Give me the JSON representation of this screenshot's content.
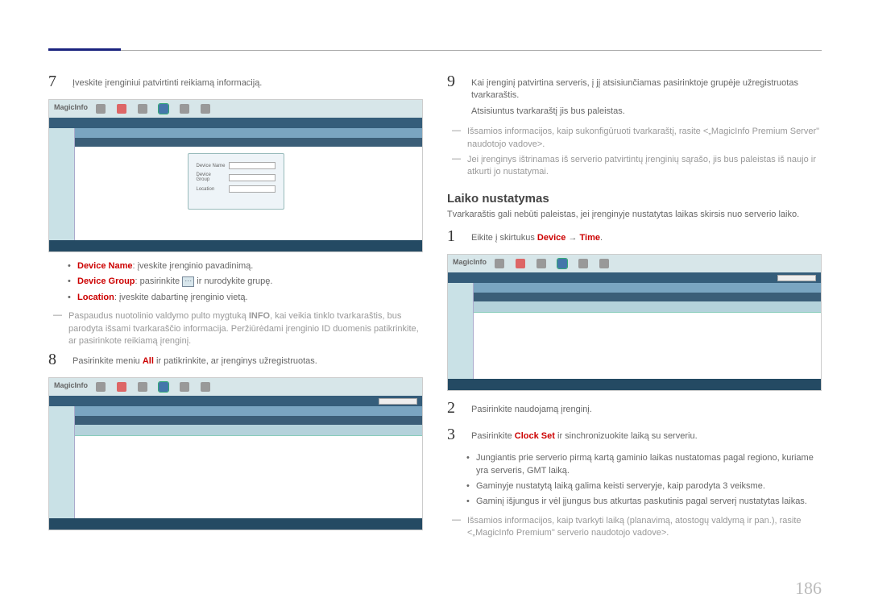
{
  "page_number": "186",
  "left": {
    "step7": {
      "num": "7",
      "text": "Įveskite įrenginiui patvirtinti reikiamą informaciją."
    },
    "bullets": [
      {
        "label": "Device Name",
        "text": ": įveskite įrenginio pavadinimą."
      },
      {
        "label": "Device Group",
        "text_before": ": pasirinkite ",
        "text_after": " ir nurodykite grupę."
      },
      {
        "label": "Location",
        "text": ": įveskite dabartinę įrenginio vietą."
      }
    ],
    "note7": {
      "text": "Paspaudus nuotolinio valdymo pulto mygtuką ",
      "bold": "INFO",
      "text2": ", kai veikia tinklo tvarkaraštis, bus parodyta išsami tvarkaraščio informacija. Peržiūrėdami įrenginio ID duomenis patikrinkite, ar pasirinkote reikiamą įrenginį."
    },
    "step8": {
      "num": "8",
      "pre": "Pasirinkite meniu ",
      "red": "All",
      "post": " ir patikrinkite, ar įrenginys užregistruotas."
    }
  },
  "right": {
    "step9": {
      "num": "9",
      "line1": "Kai įrenginį patvirtina serveris, į jį atsisiunčiamas pasirinktoje grupėje užregistruotas tvarkaraštis.",
      "line2": "Atsisiuntus tvarkaraštį jis bus paleistas."
    },
    "note9a": "Išsamios informacijos, kaip sukonfigūruoti tvarkaraštį, rasite <„MagicInfo Premium Server\" naudotojo vadove>.",
    "note9b": "Jei įrenginys ištrinamas iš serverio patvirtintų įrenginių sąrašo, jis bus paleistas iš naujo ir atkurti jo nustatymai.",
    "section_title": "Laiko nustatymas",
    "section_intro": "Tvarkaraštis gali nebūti paleistas, jei įrenginyje nustatytas laikas skirsis nuo serverio laiko.",
    "step1": {
      "num": "1",
      "pre": "Eikite į skirtukus ",
      "red1": "Device",
      "arrow": " → ",
      "red2": "Time",
      "post": "."
    },
    "step2": {
      "num": "2",
      "text": "Pasirinkite naudojamą įrenginį."
    },
    "step3": {
      "num": "3",
      "pre": "Pasirinkite ",
      "red": "Clock Set",
      "post": " ir sinchronizuokite laiką su serveriu."
    },
    "bullets2": [
      "Jungiantis prie serverio pirmą kartą gaminio laikas nustatomas pagal regiono, kuriame yra serveris, GMT laiką.",
      "Gaminyje nustatytą laiką galima keisti serveryje, kaip parodyta 3 veiksme.",
      "Gaminį išjungus ir vėl įjungus bus atkurtas paskutinis pagal serverį nustatytas laikas."
    ],
    "note3": "Išsamios informacijos, kaip tvarkyti laiką (planavimą, atostogų valdymą ir pan.), rasite <„MagicInfo Premium\" serverio naudotojo vadove>."
  },
  "screenshot_label": "MagicInfo"
}
